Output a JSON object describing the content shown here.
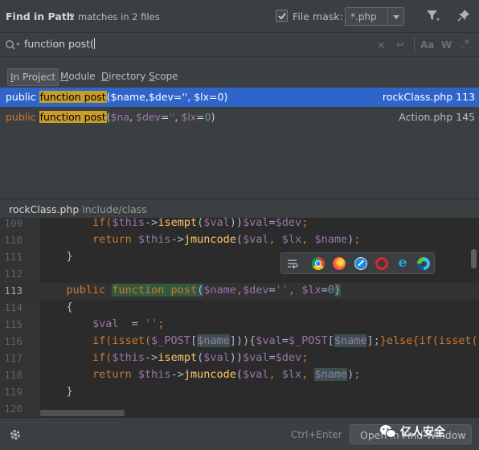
{
  "header": {
    "title": "Find in Path",
    "matches": "2 matches in 2 files",
    "file_mask_label": "File mask:",
    "file_mask_checked": true,
    "file_mask_value": "*.php",
    "filter_icon": "funnel-icon",
    "pin_icon": "pin-icon"
  },
  "search": {
    "query": "function post(",
    "match_case_label": "Aa",
    "words_label": "W",
    "regex_label": ".*"
  },
  "scopes": [
    {
      "label": "In Project",
      "mnemonic": "I",
      "rest": "n Project",
      "active": true
    },
    {
      "label": "Module",
      "mnemonic": "M",
      "rest": "odule",
      "active": false
    },
    {
      "label": "Directory",
      "mnemonic": "D",
      "rest": "irectory",
      "active": false
    },
    {
      "label": "Scope",
      "mnemonic": "S",
      "rest": "cope",
      "active": false
    }
  ],
  "results": [
    {
      "prefix": "public ",
      "match": "function post",
      "params": [
        {
          "t": "(",
          "c": "r-plain"
        },
        {
          "t": "$name",
          "c": "r-var"
        },
        {
          "t": ",",
          "c": "r-plain"
        },
        {
          "t": "$dev",
          "c": "r-var"
        },
        {
          "t": "=",
          "c": "r-plain"
        },
        {
          "t": "''",
          "c": "r-str"
        },
        {
          "t": ", ",
          "c": "r-plain"
        },
        {
          "t": "$lx",
          "c": "r-var"
        },
        {
          "t": "=",
          "c": "r-plain"
        },
        {
          "t": "0",
          "c": "r-num"
        },
        {
          "t": ")",
          "c": "r-plain"
        }
      ],
      "file": "rockClass.php 113",
      "selected": true
    },
    {
      "prefix": "public ",
      "match": "function post",
      "params": [
        {
          "t": "(",
          "c": "r-plain"
        },
        {
          "t": "$na",
          "c": "r-var"
        },
        {
          "t": ", ",
          "c": "r-plain"
        },
        {
          "t": "$dev",
          "c": "r-var"
        },
        {
          "t": "=",
          "c": "r-plain"
        },
        {
          "t": "''",
          "c": "r-str"
        },
        {
          "t": ", ",
          "c": "r-plain"
        },
        {
          "t": "$lx",
          "c": "r-var"
        },
        {
          "t": "=",
          "c": "r-plain"
        },
        {
          "t": "0",
          "c": "r-num"
        },
        {
          "t": ")",
          "c": "r-plain"
        }
      ],
      "file": "Action.php 145",
      "selected": false
    }
  ],
  "preview": {
    "file_name": "rockClass.php",
    "file_path": "include/class",
    "current_line": 113,
    "lines": [
      {
        "n": "109",
        "tokens": [
          {
            "t": "        if(",
            "c": "c-kw"
          },
          {
            "t": "$this",
            "c": "c-var"
          },
          {
            "t": "->",
            "c": "c-plain"
          },
          {
            "t": "isempt",
            "c": "c-fn"
          },
          {
            "t": "(",
            "c": "c-plain"
          },
          {
            "t": "$val",
            "c": "c-var"
          },
          {
            "t": "))",
            "c": "c-plain"
          },
          {
            "t": "$val",
            "c": "c-var"
          },
          {
            "t": "=",
            "c": "c-plain"
          },
          {
            "t": "$dev",
            "c": "c-var"
          },
          {
            "t": ";",
            "c": "c-kw"
          }
        ]
      },
      {
        "n": "110",
        "tokens": [
          {
            "t": "        return ",
            "c": "c-kw"
          },
          {
            "t": "$this",
            "c": "c-var"
          },
          {
            "t": "->",
            "c": "c-plain"
          },
          {
            "t": "jmuncode",
            "c": "c-fn"
          },
          {
            "t": "(",
            "c": "c-plain"
          },
          {
            "t": "$val",
            "c": "c-var"
          },
          {
            "t": ", ",
            "c": "c-kw"
          },
          {
            "t": "$lx",
            "c": "c-var"
          },
          {
            "t": ", ",
            "c": "c-kw"
          },
          {
            "t": "$name",
            "c": "c-var"
          },
          {
            "t": ")",
            "c": "c-plain"
          },
          {
            "t": ";",
            "c": "c-kw"
          }
        ]
      },
      {
        "n": "111",
        "tokens": [
          {
            "t": "    }",
            "c": "c-plain"
          }
        ]
      },
      {
        "n": "112",
        "tokens": []
      },
      {
        "n": "113",
        "tokens": [
          {
            "t": "    public ",
            "c": "c-kw"
          },
          {
            "t": "function post",
            "c": "c-kw c-match"
          },
          {
            "t": "(",
            "c": "c-plain c-paren"
          },
          {
            "t": "$name",
            "c": "c-var"
          },
          {
            "t": ",",
            "c": "c-kw"
          },
          {
            "t": "$dev",
            "c": "c-var"
          },
          {
            "t": "=",
            "c": "c-plain"
          },
          {
            "t": "''",
            "c": "c-str"
          },
          {
            "t": ", ",
            "c": "c-kw"
          },
          {
            "t": "$lx",
            "c": "c-var"
          },
          {
            "t": "=",
            "c": "c-plain"
          },
          {
            "t": "0",
            "c": "c-num"
          },
          {
            "t": ")",
            "c": "c-plain c-paren"
          }
        ]
      },
      {
        "n": "114",
        "tokens": [
          {
            "t": "    {",
            "c": "c-plain"
          }
        ]
      },
      {
        "n": "115",
        "tokens": [
          {
            "t": "        ",
            "c": "c-plain"
          },
          {
            "t": "$val",
            "c": "c-var"
          },
          {
            "t": "  = ",
            "c": "c-plain"
          },
          {
            "t": "''",
            "c": "c-str"
          },
          {
            "t": ";",
            "c": "c-kw"
          }
        ]
      },
      {
        "n": "116",
        "tokens": [
          {
            "t": "        if(isset(",
            "c": "c-kw"
          },
          {
            "t": "$_POST",
            "c": "c-var"
          },
          {
            "t": "[",
            "c": "c-plain"
          },
          {
            "t": "$name",
            "c": "c-var c-brace"
          },
          {
            "t": "])){",
            "c": "c-plain"
          },
          {
            "t": "$val",
            "c": "c-var"
          },
          {
            "t": "=",
            "c": "c-plain"
          },
          {
            "t": "$_POST",
            "c": "c-var"
          },
          {
            "t": "[",
            "c": "c-plain"
          },
          {
            "t": "$name",
            "c": "c-var c-brace"
          },
          {
            "t": "];",
            "c": "c-plain"
          },
          {
            "t": "}else{if(isset(",
            "c": "c-kw"
          },
          {
            "t": "$_",
            "c": "c-var"
          }
        ]
      },
      {
        "n": "117",
        "tokens": [
          {
            "t": "        if(",
            "c": "c-kw"
          },
          {
            "t": "$this",
            "c": "c-var"
          },
          {
            "t": "->",
            "c": "c-plain"
          },
          {
            "t": "isempt",
            "c": "c-fn"
          },
          {
            "t": "(",
            "c": "c-plain"
          },
          {
            "t": "$val",
            "c": "c-var"
          },
          {
            "t": "))",
            "c": "c-plain"
          },
          {
            "t": "$val",
            "c": "c-var"
          },
          {
            "t": "=",
            "c": "c-plain"
          },
          {
            "t": "$dev",
            "c": "c-var"
          },
          {
            "t": ";",
            "c": "c-kw"
          }
        ]
      },
      {
        "n": "118",
        "tokens": [
          {
            "t": "        return ",
            "c": "c-kw"
          },
          {
            "t": "$this",
            "c": "c-var"
          },
          {
            "t": "->",
            "c": "c-plain"
          },
          {
            "t": "jmuncode",
            "c": "c-fn"
          },
          {
            "t": "(",
            "c": "c-plain"
          },
          {
            "t": "$val",
            "c": "c-var"
          },
          {
            "t": ", ",
            "c": "c-kw"
          },
          {
            "t": "$lx",
            "c": "c-var"
          },
          {
            "t": ", ",
            "c": "c-kw"
          },
          {
            "t": "$name",
            "c": "c-var c-brace"
          },
          {
            "t": ")",
            "c": "c-plain"
          },
          {
            "t": ";",
            "c": "c-kw"
          }
        ]
      },
      {
        "n": "119",
        "tokens": [
          {
            "t": "    }",
            "c": "c-plain"
          }
        ]
      },
      {
        "n": "120",
        "tokens": []
      }
    ]
  },
  "browser_popup": {
    "icons": [
      "embed-icon",
      "chrome-icon",
      "firefox-icon",
      "safari-icon",
      "opera-icon",
      "ie-icon",
      "edge-icon"
    ]
  },
  "footer": {
    "settings_icon": "gear-icon",
    "shortcut": "Ctrl+Enter",
    "open_button": "Open in Find Window",
    "watermark": "亿人安全"
  }
}
